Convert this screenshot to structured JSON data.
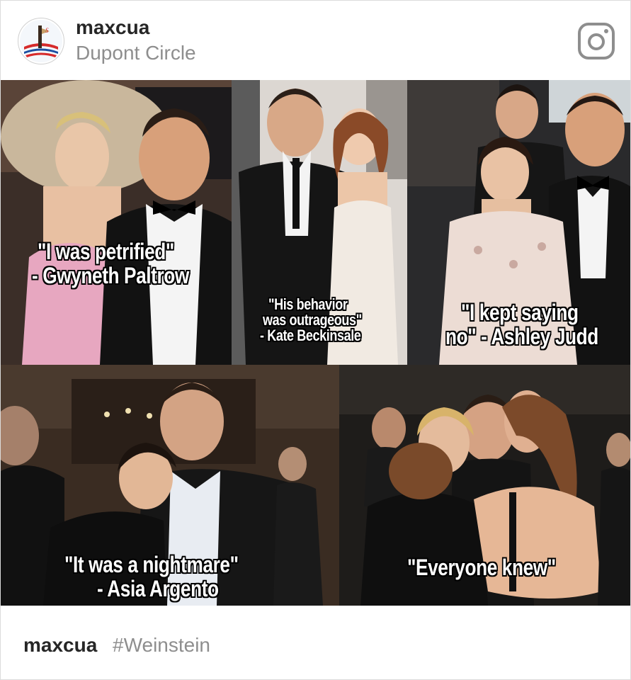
{
  "post": {
    "username": "maxcua",
    "location": "Dupont Circle"
  },
  "captions": {
    "gwyneth_line1": "\"I was petrified\"",
    "gwyneth_line2": "- Gwyneth Paltrow",
    "kate_line1": "\"His behavior",
    "kate_line2": "was outrageous\"",
    "kate_line3": "- Kate Beckinsale",
    "ashley_line1": "\"I kept saying",
    "ashley_line2": "no\" - Ashley Judd",
    "asia_line1": "\"It was a nightmare\"",
    "asia_line2": "- Asia Argento",
    "everyone": "\"Everyone knew\""
  },
  "footer": {
    "username": "maxcua",
    "hashtag": "#Weinstein"
  },
  "icons": {
    "platform": "instagram-icon",
    "avatar": "profile-avatar"
  },
  "colors": {
    "text_primary": "#262626",
    "text_secondary": "#8e8e8e",
    "caption_fill": "#ffffff",
    "caption_outline": "#000000"
  }
}
